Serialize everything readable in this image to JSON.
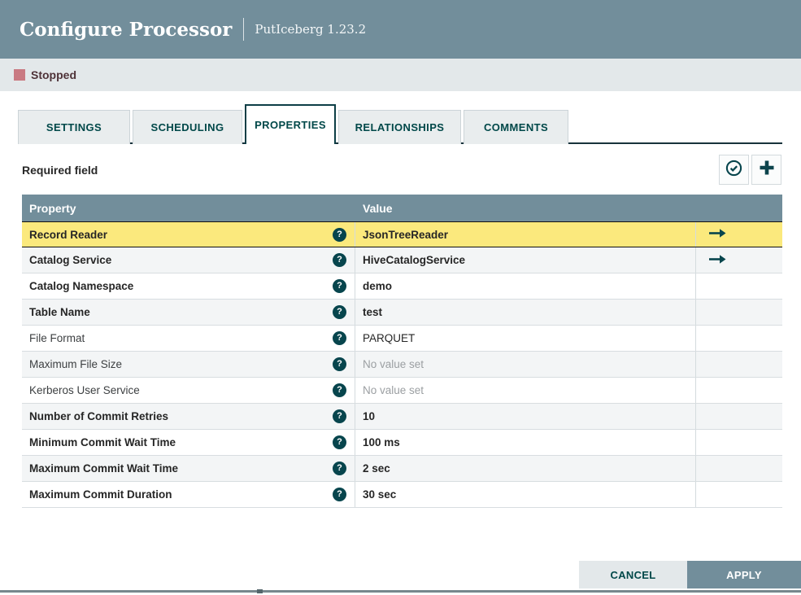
{
  "dialog": {
    "title": "Configure Processor",
    "processor": "PutIceberg 1.23.2"
  },
  "status": {
    "label": "Stopped",
    "color": "#c97a82"
  },
  "tabs": [
    {
      "label": "SETTINGS",
      "active": false
    },
    {
      "label": "SCHEDULING",
      "active": false
    },
    {
      "label": "PROPERTIES",
      "active": true
    },
    {
      "label": "RELATIONSHIPS",
      "active": false
    },
    {
      "label": "COMMENTS",
      "active": false
    }
  ],
  "properties_panel": {
    "required_field_label": "Required field",
    "toolbar": {
      "verify_icon": "check-circle",
      "add_property_icon": "plus"
    },
    "table": {
      "columns": [
        "Property",
        "Value"
      ],
      "help_icon_glyph": "?",
      "rows": [
        {
          "property": "Record Reader",
          "value": "JsonTreeReader",
          "required": true,
          "no_value": false,
          "selected": true,
          "controller_service_link": true
        },
        {
          "property": "Catalog Service",
          "value": "HiveCatalogService",
          "required": true,
          "no_value": false,
          "selected": false,
          "controller_service_link": true
        },
        {
          "property": "Catalog Namespace",
          "value": "demo",
          "required": true,
          "no_value": false,
          "selected": false,
          "controller_service_link": false
        },
        {
          "property": "Table Name",
          "value": "test",
          "required": true,
          "no_value": false,
          "selected": false,
          "controller_service_link": false
        },
        {
          "property": "File Format",
          "value": "PARQUET",
          "required": false,
          "no_value": false,
          "selected": false,
          "controller_service_link": false
        },
        {
          "property": "Maximum File Size",
          "value": "No value set",
          "required": false,
          "no_value": true,
          "selected": false,
          "controller_service_link": false
        },
        {
          "property": "Kerberos User Service",
          "value": "No value set",
          "required": false,
          "no_value": true,
          "selected": false,
          "controller_service_link": false
        },
        {
          "property": "Number of Commit Retries",
          "value": "10",
          "required": true,
          "no_value": false,
          "selected": false,
          "controller_service_link": false
        },
        {
          "property": "Minimum Commit Wait Time",
          "value": "100 ms",
          "required": true,
          "no_value": false,
          "selected": false,
          "controller_service_link": false
        },
        {
          "property": "Maximum Commit Wait Time",
          "value": "2 sec",
          "required": true,
          "no_value": false,
          "selected": false,
          "controller_service_link": false
        },
        {
          "property": "Maximum Commit Duration",
          "value": "30 sec",
          "required": true,
          "no_value": false,
          "selected": false,
          "controller_service_link": false
        }
      ]
    }
  },
  "footer": {
    "cancel_label": "CANCEL",
    "apply_label": "APPLY"
  },
  "colors": {
    "accent_teal": "#004849",
    "header_slate": "#728e9b",
    "selected_row_yellow": "#fbe97d",
    "stopped_rose": "#c97a82"
  }
}
